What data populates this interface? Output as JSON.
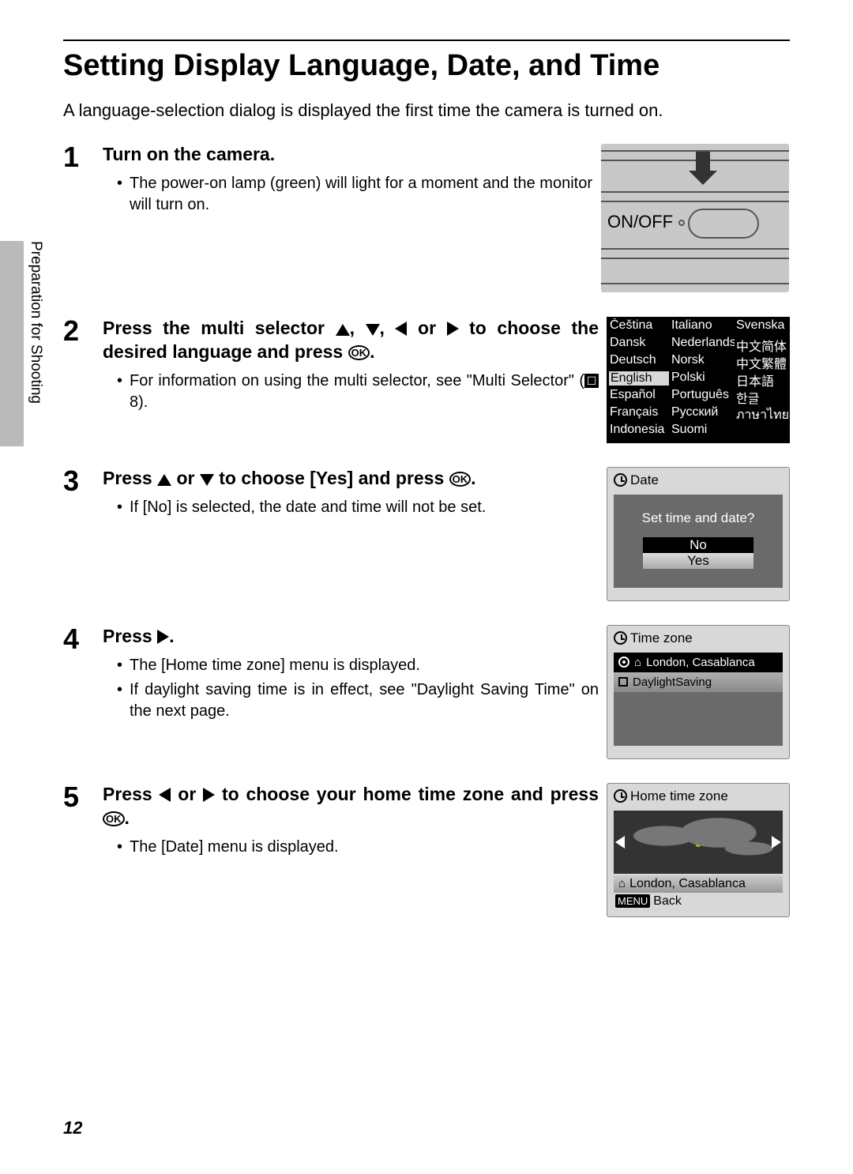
{
  "page_number": "12",
  "side_tab": "Preparation for Shooting",
  "title": "Setting Display Language, Date, and Time",
  "intro": "A language-selection dialog is displayed the first time the camera is turned on.",
  "step1": {
    "title": "Turn on the camera.",
    "bullet1": "The power-on lamp (green) will light for a moment and the monitor will turn on.",
    "switch_label": "ON/OFF"
  },
  "step2": {
    "title_a": "Press the multi selector ",
    "title_b": " to choose the desired language and press ",
    "bullet_a": "For information on using the multi selector, see \"Multi Selector\" (",
    "bullet_b": " 8).",
    "langs": {
      "c1": [
        "Čeština",
        "Dansk",
        "Deutsch",
        "English",
        "Español",
        "Français",
        "Indonesia"
      ],
      "c2": [
        "Italiano",
        "Nederlands",
        "Norsk",
        "Polski",
        "Português",
        "Русский",
        "Suomi"
      ],
      "c3": [
        "Svenska",
        "中文简体",
        "中文繁體",
        "日本語",
        "한글",
        "ภาษาไทย",
        ""
      ]
    }
  },
  "step3": {
    "title_a": "Press ",
    "title_b": " to choose [Yes] and press ",
    "bullet1": "If [No] is selected, the date and time will not be set.",
    "scr_title": "Date",
    "prompt": "Set time and date?",
    "opt_no": "No",
    "opt_yes": "Yes"
  },
  "step4": {
    "title_a": "Press ",
    "bullet1": "The [Home time zone] menu is displayed.",
    "bullet2": "If daylight saving time is in effect, see \"Daylight Saving Time\" on the next page.",
    "scr_title": "Time zone",
    "row1": "London, Casablanca",
    "row2": "DaylightSaving"
  },
  "step5": {
    "title_a": "Press ",
    "title_b": "  to choose your home time zone and press ",
    "bullet1": "The [Date] menu is displayed.",
    "scr_title": "Home time zone",
    "tz": "London, Casablanca",
    "menu": "MENU",
    "back": "Back"
  },
  "glyphs": {
    "comma": ", ",
    "or": " or ",
    "period": ".",
    "ok": "OK",
    "ref": " "
  }
}
